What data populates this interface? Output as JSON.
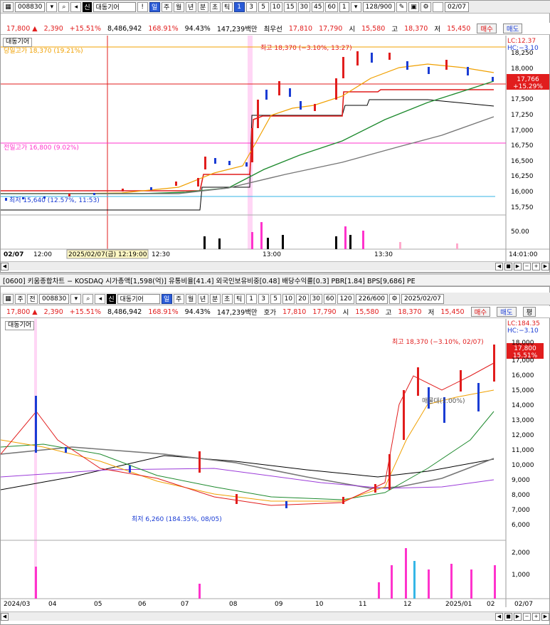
{
  "chart1": {
    "toolbar": {
      "code": "008830",
      "name_tag": "신",
      "name": "대동기어",
      "periods": [
        "일",
        "주",
        "월",
        "년",
        "분",
        "초",
        "틱"
      ],
      "active_period": "분",
      "intervals": [
        "1",
        "3",
        "5",
        "10",
        "15",
        "30",
        "45",
        "60"
      ],
      "active_interval": "1",
      "count_value": "1",
      "range": "128/900",
      "date": "02/07"
    },
    "quote": {
      "price": "17,800 ▲",
      "change": "2,390",
      "change_pct": "+15.51%",
      "volume": "8,486,942",
      "vol_ratio": "168.91%",
      "rate2": "94.43%",
      "amount": "147,239백만",
      "best_label": "최우선",
      "ask": "17,810",
      "bid": "17,790",
      "open_label": "시",
      "open": "15,580",
      "high_label": "고",
      "high": "18,370",
      "low_label": "저",
      "low": "15,450",
      "buy_label": "매수",
      "sell_label": "매도"
    },
    "legend_name": "대동기어",
    "today_high_label": "당일고가 18,370 (19.21%)",
    "prev_high_label": "전일고가 16,800 (9.02%)",
    "max_label": "최고 18,370 (−3.10%, 13:27)",
    "min_label": "최저 15,640 (12.57%, 11:53)",
    "lc": "LC:12.37",
    "hc": "HC:−3.10",
    "price_box": "17,766",
    "price_box_pct": "+15.29%",
    "y_ticks": [
      "18,250",
      "18,000",
      "17,750",
      "17,500",
      "17,250",
      "17,000",
      "16,750",
      "16,500",
      "16,250",
      "16,000",
      "15,750"
    ],
    "vol_tick": "50.00",
    "x_labels": [
      "02/07",
      "12:00",
      "2025/02/07(금) 12:19:00",
      "12:30",
      "13:00",
      "13:30",
      "14:01:00"
    ]
  },
  "chart2": {
    "title": "[0600] 키움종합차트 − KOSDAQ 시가총액[1,598(억)] 유통비율[41.4] 외국인보유비중[0.48] 배당수익률[0.3] PBR[1.84] BPS[9,686] PE",
    "toolbar": {
      "prefix1": "주",
      "prefix2": "전",
      "code": "008830",
      "name_tag": "신",
      "name": "대동기어",
      "periods": [
        "일",
        "주",
        "월",
        "년",
        "분",
        "초",
        "틱"
      ],
      "active_period": "일",
      "intervals": [
        "1",
        "3",
        "5",
        "10",
        "20",
        "30",
        "60",
        "120"
      ],
      "range": "226/600",
      "date": "2025/02/07"
    },
    "quote": {
      "price": "17,800 ▲",
      "change": "2,390",
      "change_pct": "+15.51%",
      "volume": "8,486,942",
      "vol_ratio": "168.91%",
      "rate2": "94.43%",
      "amount": "147,239백만",
      "best_label": "호가",
      "ask": "17,810",
      "bid": "17,790",
      "open_label": "시",
      "open": "15,580",
      "high_label": "고",
      "high": "18,370",
      "low_label": "저",
      "low": "15,450",
      "buy_label": "매수",
      "sell_label": "매도",
      "extra": "평"
    },
    "legend_name": "대동기어",
    "max_label": "최고 18,370 (−3.10%, 02/07)",
    "min_label": "최저 6,260 (184.35%, 08/05)",
    "mid_label": "매물대(1.00%)",
    "lc": "LC:184.35",
    "hc": "HC:−3.10",
    "price_box": "17,800",
    "price_box_pct": "15.51%",
    "y_ticks": [
      "18,000",
      "17,000",
      "16,000",
      "15,000",
      "14,000",
      "13,000",
      "12,000",
      "11,000",
      "10,000",
      "9,000",
      "8,000",
      "7,000",
      "6,000"
    ],
    "vol_ticks": [
      "2,000",
      "1,000"
    ],
    "x_labels": [
      "2024/03",
      "04",
      "05",
      "06",
      "07",
      "08",
      "09",
      "10",
      "11",
      "12",
      "2025/01",
      "02",
      "02/07"
    ]
  },
  "colors": {
    "up": "#e11d1d",
    "down": "#1a3cd4",
    "ma5": "#e11d1d",
    "ma20": "#f0a000",
    "ma60": "#1e8a2e",
    "ma120": "#777777",
    "pink": "#ff33cc"
  }
}
